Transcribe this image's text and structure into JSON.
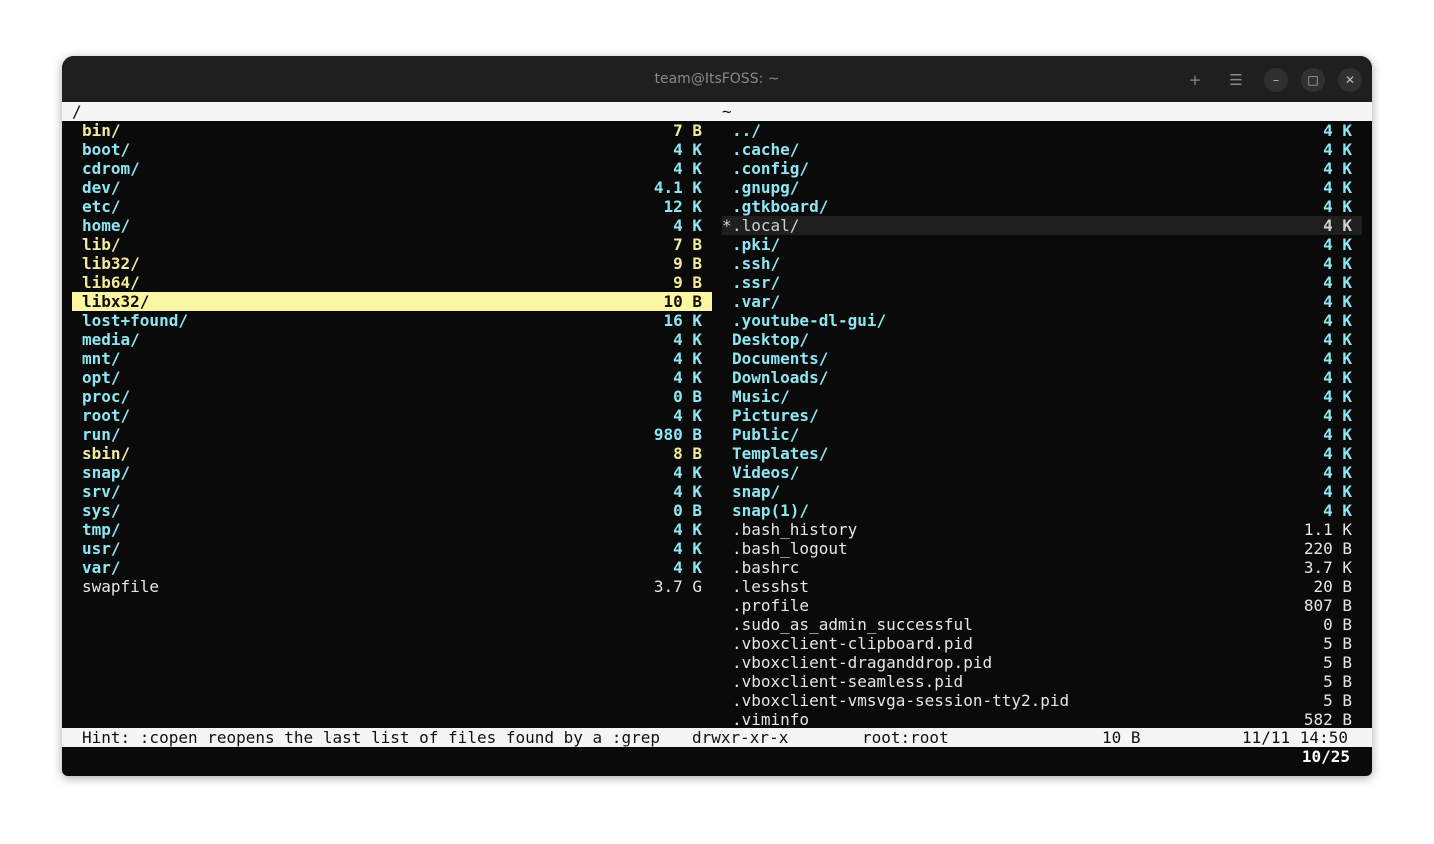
{
  "window": {
    "title": "team@ItsFOSS: ~",
    "buttons": {
      "new_tab": "+",
      "menu": "☰",
      "minimize": "–",
      "maximize": "□",
      "close": "✕"
    }
  },
  "left_pane": {
    "path": "/",
    "items": [
      {
        "name": "bin/",
        "size": "7 B",
        "type": "link"
      },
      {
        "name": "boot/",
        "size": "4 K",
        "type": "dir"
      },
      {
        "name": "cdrom/",
        "size": "4 K",
        "type": "dir"
      },
      {
        "name": "dev/",
        "size": "4.1 K",
        "type": "dir"
      },
      {
        "name": "etc/",
        "size": "12 K",
        "type": "dir"
      },
      {
        "name": "home/",
        "size": "4 K",
        "type": "dir"
      },
      {
        "name": "lib/",
        "size": "7 B",
        "type": "link"
      },
      {
        "name": "lib32/",
        "size": "9 B",
        "type": "link"
      },
      {
        "name": "lib64/",
        "size": "9 B",
        "type": "link"
      },
      {
        "name": "libx32/",
        "size": "10 B",
        "type": "link",
        "selected": true
      },
      {
        "name": "lost+found/",
        "size": "16 K",
        "type": "dir"
      },
      {
        "name": "media/",
        "size": "4 K",
        "type": "dir"
      },
      {
        "name": "mnt/",
        "size": "4 K",
        "type": "dir"
      },
      {
        "name": "opt/",
        "size": "4 K",
        "type": "dir"
      },
      {
        "name": "proc/",
        "size": "0 B",
        "type": "dir"
      },
      {
        "name": "root/",
        "size": "4 K",
        "type": "dir"
      },
      {
        "name": "run/",
        "size": "980 B",
        "type": "dir"
      },
      {
        "name": "sbin/",
        "size": "8 B",
        "type": "link"
      },
      {
        "name": "snap/",
        "size": "4 K",
        "type": "dir"
      },
      {
        "name": "srv/",
        "size": "4 K",
        "type": "dir"
      },
      {
        "name": "sys/",
        "size": "0 B",
        "type": "dir"
      },
      {
        "name": "tmp/",
        "size": "4 K",
        "type": "dir"
      },
      {
        "name": "usr/",
        "size": "4 K",
        "type": "dir"
      },
      {
        "name": "var/",
        "size": "4 K",
        "type": "dir"
      },
      {
        "name": "swapfile",
        "size": "3.7 G",
        "type": "file"
      }
    ]
  },
  "right_pane": {
    "path": "~",
    "items": [
      {
        "name": "../",
        "size": "4 K",
        "type": "dir"
      },
      {
        "name": ".cache/",
        "size": "4 K",
        "type": "dir"
      },
      {
        "name": ".config/",
        "size": "4 K",
        "type": "dir"
      },
      {
        "name": ".gnupg/",
        "size": "4 K",
        "type": "dir"
      },
      {
        "name": ".gtkboard/",
        "size": "4 K",
        "type": "dir"
      },
      {
        "name": ".local/",
        "size": "4 K",
        "type": "dir",
        "cursor": true,
        "marker": "*"
      },
      {
        "name": ".pki/",
        "size": "4 K",
        "type": "dir"
      },
      {
        "name": ".ssh/",
        "size": "4 K",
        "type": "dir"
      },
      {
        "name": ".ssr/",
        "size": "4 K",
        "type": "dir"
      },
      {
        "name": ".var/",
        "size": "4 K",
        "type": "dir"
      },
      {
        "name": ".youtube-dl-gui/",
        "size": "4 K",
        "type": "dir"
      },
      {
        "name": "Desktop/",
        "size": "4 K",
        "type": "dir"
      },
      {
        "name": "Documents/",
        "size": "4 K",
        "type": "dir"
      },
      {
        "name": "Downloads/",
        "size": "4 K",
        "type": "dir"
      },
      {
        "name": "Music/",
        "size": "4 K",
        "type": "dir"
      },
      {
        "name": "Pictures/",
        "size": "4 K",
        "type": "dir"
      },
      {
        "name": "Public/",
        "size": "4 K",
        "type": "dir"
      },
      {
        "name": "Templates/",
        "size": "4 K",
        "type": "dir"
      },
      {
        "name": "Videos/",
        "size": "4 K",
        "type": "dir"
      },
      {
        "name": "snap/",
        "size": "4 K",
        "type": "dir"
      },
      {
        "name": "snap(1)/",
        "size": "4 K",
        "type": "dir"
      },
      {
        "name": ".bash_history",
        "size": "1.1 K",
        "type": "file"
      },
      {
        "name": ".bash_logout",
        "size": "220 B",
        "type": "file"
      },
      {
        "name": ".bashrc",
        "size": "3.7 K",
        "type": "file"
      },
      {
        "name": ".lesshst",
        "size": "20 B",
        "type": "file"
      },
      {
        "name": ".profile",
        "size": "807 B",
        "type": "file"
      },
      {
        "name": ".sudo_as_admin_successful",
        "size": "0 B",
        "type": "file"
      },
      {
        "name": ".vboxclient-clipboard.pid",
        "size": "5 B",
        "type": "file"
      },
      {
        "name": ".vboxclient-draganddrop.pid",
        "size": "5 B",
        "type": "file"
      },
      {
        "name": ".vboxclient-seamless.pid",
        "size": "5 B",
        "type": "file"
      },
      {
        "name": ".vboxclient-vmsvga-session-tty2.pid",
        "size": "5 B",
        "type": "file"
      },
      {
        "name": ".viminfo",
        "size": "582 B",
        "type": "file"
      }
    ]
  },
  "statusbar": {
    "hint": "Hint: :copen reopens the last list of files found by a :grep",
    "permissions": "drwxr-xr-x",
    "owner": "root:root",
    "size": "10 B",
    "datetime": "11/11 14:50"
  },
  "position": "10/25"
}
